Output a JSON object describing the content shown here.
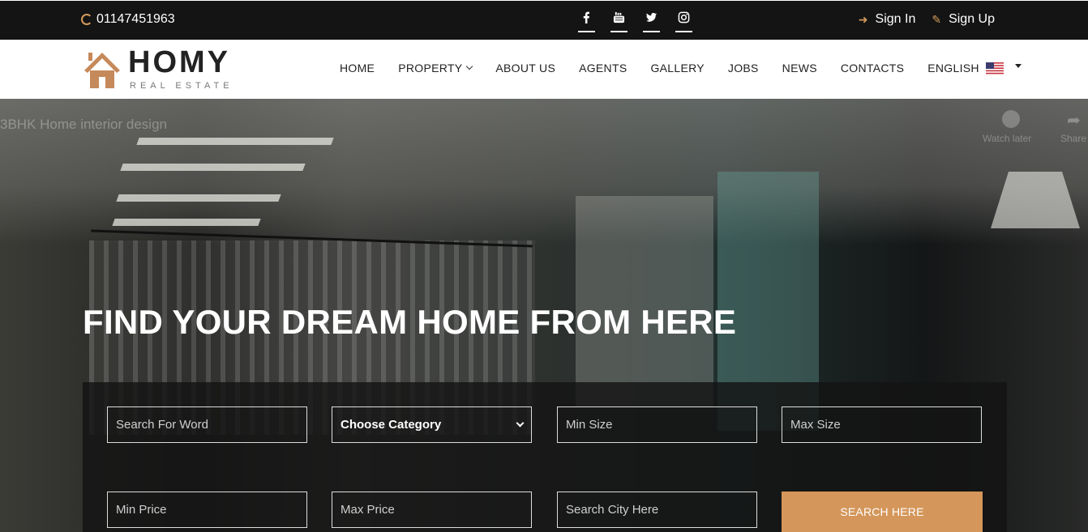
{
  "topbar": {
    "phone": "01147451963",
    "socials": [
      {
        "name": "facebook-icon",
        "glyph": "f"
      },
      {
        "name": "youtube-icon",
        "glyph": "yt"
      },
      {
        "name": "twitter-icon",
        "glyph": "tw"
      },
      {
        "name": "instagram-icon",
        "glyph": "ig"
      }
    ],
    "sign_in": "Sign In",
    "sign_up": "Sign Up"
  },
  "logo": {
    "title": "HOMY",
    "subtitle": "REAL ESTATE"
  },
  "nav": {
    "items": [
      "HOME",
      "PROPERTY",
      "ABOUT US",
      "AGENTS",
      "GALLERY",
      "JOBS",
      "NEWS",
      "CONTACTS"
    ],
    "language": "ENGLISH"
  },
  "video_overlay": {
    "title": "3BHK Home interior design",
    "watch_later": "Watch later",
    "share": "Share"
  },
  "hero": {
    "title": "FIND YOUR DREAM HOME FROM HERE"
  },
  "search": {
    "word_placeholder": "Search For Word",
    "category": "Choose Category",
    "min_size": "Min Size",
    "max_size": "Max Size",
    "min_price": "Min Price",
    "max_price": "Max Price",
    "city_placeholder": "Search City Here",
    "button": "SEARCH HERE"
  },
  "colors": {
    "accent": "#d4965a",
    "topbar_bg": "#141414"
  }
}
